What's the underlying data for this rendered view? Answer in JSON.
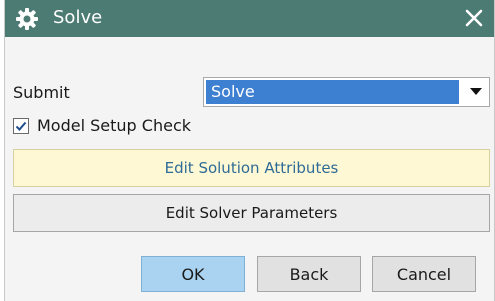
{
  "window": {
    "title": "Solve",
    "title_icon": "gear-icon",
    "close_icon": "close-icon"
  },
  "submit": {
    "label": "Submit",
    "selected": "Solve"
  },
  "model_setup_check": {
    "label": "Model Setup Check",
    "checked": true
  },
  "buttons": {
    "edit_solution_attributes": "Edit Solution Attributes",
    "edit_solver_parameters": "Edit Solver Parameters",
    "ok": "OK",
    "back": "Back",
    "cancel": "Cancel"
  },
  "colors": {
    "titlebar": "#4b7b73",
    "selection": "#3d7fd0",
    "highlight_button": "#fff8d4",
    "default_button": "#a9d3f0"
  }
}
